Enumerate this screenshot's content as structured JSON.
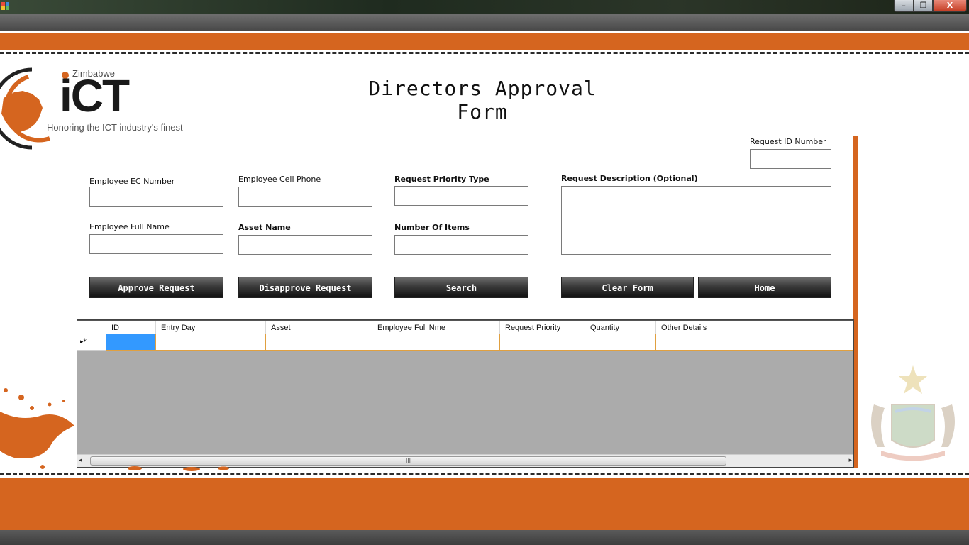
{
  "window": {
    "minimize_glyph": "–",
    "maximize_glyph": "❐",
    "close_glyph": "X"
  },
  "logo": {
    "country": "Zimbabwe",
    "brand": "iCT",
    "tagline": "Honoring the ICT industry's finest"
  },
  "page": {
    "title": "Directors Approval Form"
  },
  "form": {
    "request_id": {
      "label": "Request  ID Number",
      "value": ""
    },
    "ec_number": {
      "label": "Employee EC Number",
      "value": ""
    },
    "cell_phone": {
      "label": "Employee Cell Phone",
      "value": ""
    },
    "priority_type": {
      "label": "Request Priority Type",
      "value": ""
    },
    "description": {
      "label": "Request Description (Optional)",
      "value": ""
    },
    "full_name": {
      "label": "Employee Full Name",
      "value": ""
    },
    "asset_name": {
      "label": "Asset Name",
      "value": ""
    },
    "num_items": {
      "label": "Number Of Items",
      "value": ""
    }
  },
  "buttons": {
    "approve": "Approve Request",
    "disapprove": "Disapprove Request",
    "search": "Search",
    "clear": "Clear Form",
    "home": "Home"
  },
  "grid": {
    "columns": [
      "ID",
      "Entry Day",
      "Asset",
      "Employee Full Nme",
      "Request Priority",
      "Quantity",
      "Other Details"
    ],
    "new_row_marker": "▸*",
    "scroll_grip": "III",
    "scroll_left": "◂",
    "scroll_right": "▸"
  },
  "colors": {
    "accent_orange": "#d5651f",
    "selected_cell": "#3399ff",
    "grid_background": "#ababab"
  }
}
